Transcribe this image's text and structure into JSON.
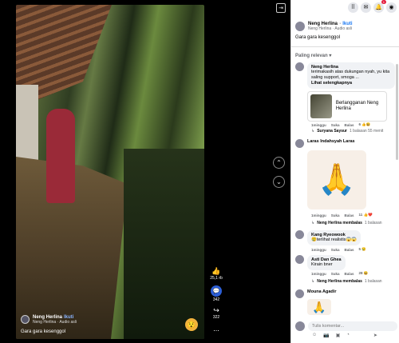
{
  "video": {
    "user": "Neng Herlina",
    "follow_label": "Ikuti",
    "audio": "Neng Herlina · Audio asli",
    "caption": "Gara gara kesenggol",
    "emoji": "😯",
    "likes": "25,1 rb",
    "comments": "342",
    "shares": "322",
    "more": "..."
  },
  "icons": {
    "expand": "expand-icon",
    "up": "chevron-up-icon",
    "down": "chevron-down-icon",
    "like": "thumbs-up-icon",
    "comment": "comment-icon",
    "share": "share-icon"
  },
  "topbar": {
    "notif_badge": "1"
  },
  "post": {
    "name": "Neng Herlina",
    "follow": "Ikuti",
    "sub": "Neng Herlina · Audio asli",
    "caption": "Gara gara kesenggol"
  },
  "sort_label": "Paling relevan",
  "comments": [
    {
      "name": "Neng Herlina",
      "text": "terimakasih atas dukungan nyah, yu kita saling support, smoga ...",
      "see_more": "Lihat selengkapnya",
      "card_text": "Berlangganan Neng Herlina",
      "time": "1minggu",
      "like": "Suka",
      "reply": "Balas",
      "reactions": "6",
      "reply_user": "Suryana Saysur",
      "reply_count": "1 balasan 55 menit"
    },
    {
      "name": "Laras Indahsyah Laras",
      "sticker": "🙏",
      "time": "1minggu",
      "like": "Suka",
      "reply": "Balas",
      "reactions": "11",
      "reply_user": "Neng Herlina membalas",
      "reply_count": "1 balasan"
    },
    {
      "name": "Kang Ryeowook",
      "text": "😢terlihat realistis😱😱",
      "time": "1minggu",
      "like": "Suka",
      "reply": "Balas",
      "reactions": "5"
    },
    {
      "name": "Asti Dan Ghea",
      "text": "Kirain bner",
      "time": "1minggu",
      "like": "Suka",
      "reply": "Balas",
      "reactions": "28",
      "reply_user": "Neng Herlina membalas",
      "reply_count": "1 balasan"
    },
    {
      "name": "Mouna Agadir",
      "sticker": "🙏"
    }
  ],
  "composer": {
    "placeholder": "Tulis komentar..."
  }
}
